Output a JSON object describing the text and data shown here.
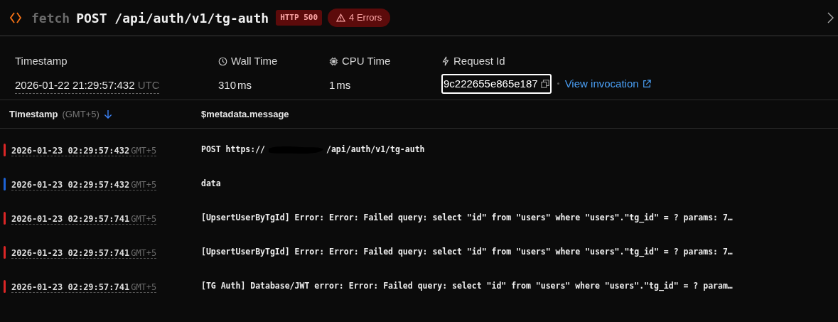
{
  "header": {
    "kind_label": "fetch",
    "title": "POST /api/auth/v1/tg-auth",
    "status_badge": "HTTP 500",
    "errors_badge": "4 Errors"
  },
  "stats": {
    "timestamp": {
      "label": "Timestamp",
      "value": "2026-01-22 21:29:57:432",
      "zone": "UTC"
    },
    "wall_time": {
      "label": "Wall Time",
      "value": "310",
      "unit": "ms"
    },
    "cpu_time": {
      "label": "CPU Time",
      "value": "1",
      "unit": "ms"
    },
    "request_id": {
      "label": "Request Id",
      "value": "9c222655e865e187",
      "link": "View invocation"
    }
  },
  "table": {
    "columns": [
      {
        "label": "Timestamp",
        "note": "(GMT+5)",
        "sorted": true
      },
      {
        "label": "$metadata.message",
        "sorted": false
      }
    ],
    "rows": [
      {
        "color": "#dc2626",
        "time": "2026-01-23 02:29:57:432",
        "zone": "GMT+5",
        "message": [
          {
            "kind": "text",
            "text": "POST https://"
          },
          {
            "kind": "redaction"
          },
          {
            "kind": "text",
            "text": "/api/auth/v1/tg-auth"
          }
        ]
      },
      {
        "color": "#1d63d6",
        "time": "2026-01-23 02:29:57:432",
        "zone": "GMT+5",
        "message": [
          {
            "kind": "text",
            "text": "data"
          }
        ]
      },
      {
        "color": "#dc2626",
        "time": "2026-01-23 02:29:57:741",
        "zone": "GMT+5",
        "message": [
          {
            "kind": "text",
            "text": "[UpsertUserByTgId] Error: Error: Failed query: select \"id\" from \"users\" where \"users\".\"tg_id\" = ? params: 7…"
          }
        ]
      },
      {
        "color": "#dc2626",
        "time": "2026-01-23 02:29:57:741",
        "zone": "GMT+5",
        "message": [
          {
            "kind": "text",
            "text": "[UpsertUserByTgId] Error: Error: Failed query: select \"id\" from \"users\" where \"users\".\"tg_id\" = ? params: 7…"
          }
        ]
      },
      {
        "color": "#dc2626",
        "time": "2026-01-23 02:29:57:741",
        "zone": "GMT+5",
        "message": [
          {
            "kind": "text",
            "text": "[TG Auth] Database/JWT error: Error: Failed query: select \"id\" from \"users\" where \"users\".\"tg_id\" = ? param…"
          }
        ]
      }
    ]
  }
}
